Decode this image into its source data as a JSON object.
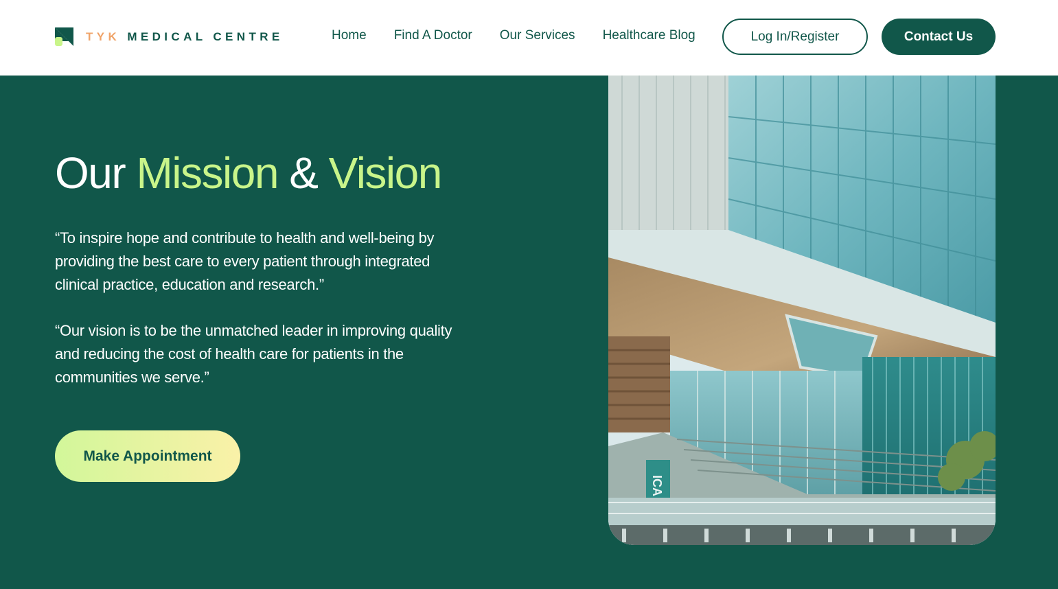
{
  "brand": {
    "logo_icon": "tyk-logo-icon",
    "name_part1": "TYK",
    "name_part2": "MEDICAL CENTRE"
  },
  "nav": {
    "items": [
      {
        "label": "Home"
      },
      {
        "label": "Find A Doctor"
      },
      {
        "label": "Our Services"
      },
      {
        "label": "Healthcare Blog"
      }
    ],
    "login_label": "Log In/Register",
    "contact_label": "Contact Us"
  },
  "hero": {
    "title_word1": "Our",
    "title_word2": "Mission",
    "title_word3": "&",
    "title_word4": "Vision",
    "mission_text": "“To inspire hope and contribute to health and well-being by providing the best care to every patient through integrated clinical practice, education and research.”",
    "vision_text": "“Our vision is to be the unmatched leader in improving quality and reducing the cost of health care for patients in the communities we serve.”",
    "cta_label": "Make Appointment"
  },
  "photo": {
    "sign_text": "ICA"
  },
  "colors": {
    "primary": "#11574a",
    "accent": "#c9f58a",
    "logo_accent": "#f0a46a",
    "white": "#ffffff"
  }
}
